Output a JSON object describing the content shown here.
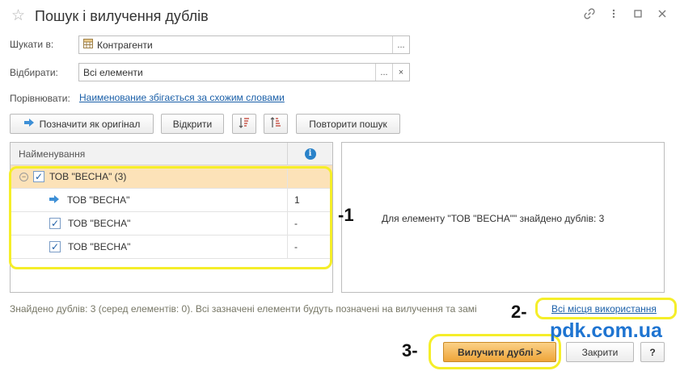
{
  "window": {
    "title": "Пошук і вилучення дублів",
    "star_glyph": "☆",
    "icons": [
      "link-icon",
      "more-icon",
      "maximize-icon",
      "close-icon"
    ]
  },
  "search_in": {
    "label": "Шукати в:",
    "value": "Контрагенти",
    "select_label": "..."
  },
  "filter": {
    "label": "Відбирати:",
    "value": "Всі елементи",
    "select_label": "...",
    "clear_label": "×"
  },
  "compare": {
    "label": "Порівнювати:",
    "link": "Наименование збігається за схожим словами"
  },
  "toolbar": {
    "mark_original": "Позначити як оригінал",
    "open": "Відкрити",
    "repeat_search": "Повторити пошук"
  },
  "table": {
    "col_name": "Найменування",
    "group": {
      "name": "ТОВ \"ВЕСНА\" (3)",
      "checked": true
    },
    "rows": [
      {
        "name": "ТОВ \"ВЕСНА\"",
        "usage": "1",
        "original": true
      },
      {
        "name": "ТОВ \"ВЕСНА\"",
        "usage": "-",
        "original": false
      },
      {
        "name": "ТОВ \"ВЕСНА\"",
        "usage": "-",
        "original": false
      }
    ]
  },
  "details": {
    "message": "Для елементу \"ТОВ \"ВЕСНА\"\" знайдено дублів: 3"
  },
  "status": {
    "text": "Знайдено дублів: 3 (серед елементів: 0). Всі зазначені елементи будуть позначені на вилучення та замі",
    "usage_link": "Всі місця використання"
  },
  "buttons": {
    "remove": "Вилучити дублі >",
    "close": "Закрити",
    "help": "?"
  },
  "annotations": {
    "a1": "-1",
    "a2": "2-",
    "a3": "3-",
    "watermark": "pdk.com.ua"
  },
  "colors": {
    "highlight": "#f5ee29",
    "group_row": "#fce2b8",
    "primary_button": "#efa539",
    "link": "#1a5fa8",
    "watermark": "#1e74d1"
  }
}
